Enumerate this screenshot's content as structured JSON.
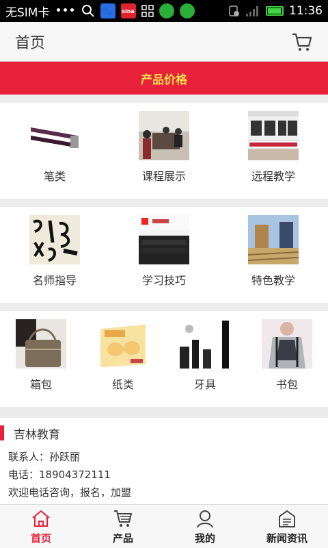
{
  "status_bar": {
    "carrier": "无SIM卡",
    "dots": "•••",
    "time": "11:36",
    "sina_text": "sina",
    "battery_level": 0.85
  },
  "header": {
    "title": "首页"
  },
  "banner": {
    "text": "产品价格"
  },
  "row1": [
    {
      "label": "笔类",
      "icon": "pen-image"
    },
    {
      "label": "课程展示",
      "icon": "classroom-image"
    },
    {
      "label": "远程教学",
      "icon": "remote-teaching-image"
    }
  ],
  "row2": [
    {
      "label": "名师指导",
      "icon": "calligraphy-image"
    },
    {
      "label": "学习技巧",
      "icon": "study-tips-image"
    },
    {
      "label": "特色教学",
      "icon": "buildings-image"
    }
  ],
  "row3": [
    {
      "label": "箱包",
      "icon": "bag-image"
    },
    {
      "label": "纸类",
      "icon": "tissue-image"
    },
    {
      "label": "牙具",
      "icon": "toothbrush-image"
    },
    {
      "label": "书包",
      "icon": "backpack-image"
    }
  ],
  "info": {
    "name": "吉林教育",
    "contact": "联系人：孙跃丽",
    "phone": "电话：18904372111",
    "welcome": "欢迎电话咨询，报名，加盟"
  },
  "nav": [
    {
      "label": "首页",
      "icon": "home-icon",
      "active": true
    },
    {
      "label": "产品",
      "icon": "cart-icon",
      "active": false
    },
    {
      "label": "我的",
      "icon": "user-icon",
      "active": false
    },
    {
      "label": "新闻资讯",
      "icon": "news-icon",
      "active": false
    }
  ],
  "colors": {
    "accent": "#e8203a",
    "banner_text": "#ffe14d"
  }
}
